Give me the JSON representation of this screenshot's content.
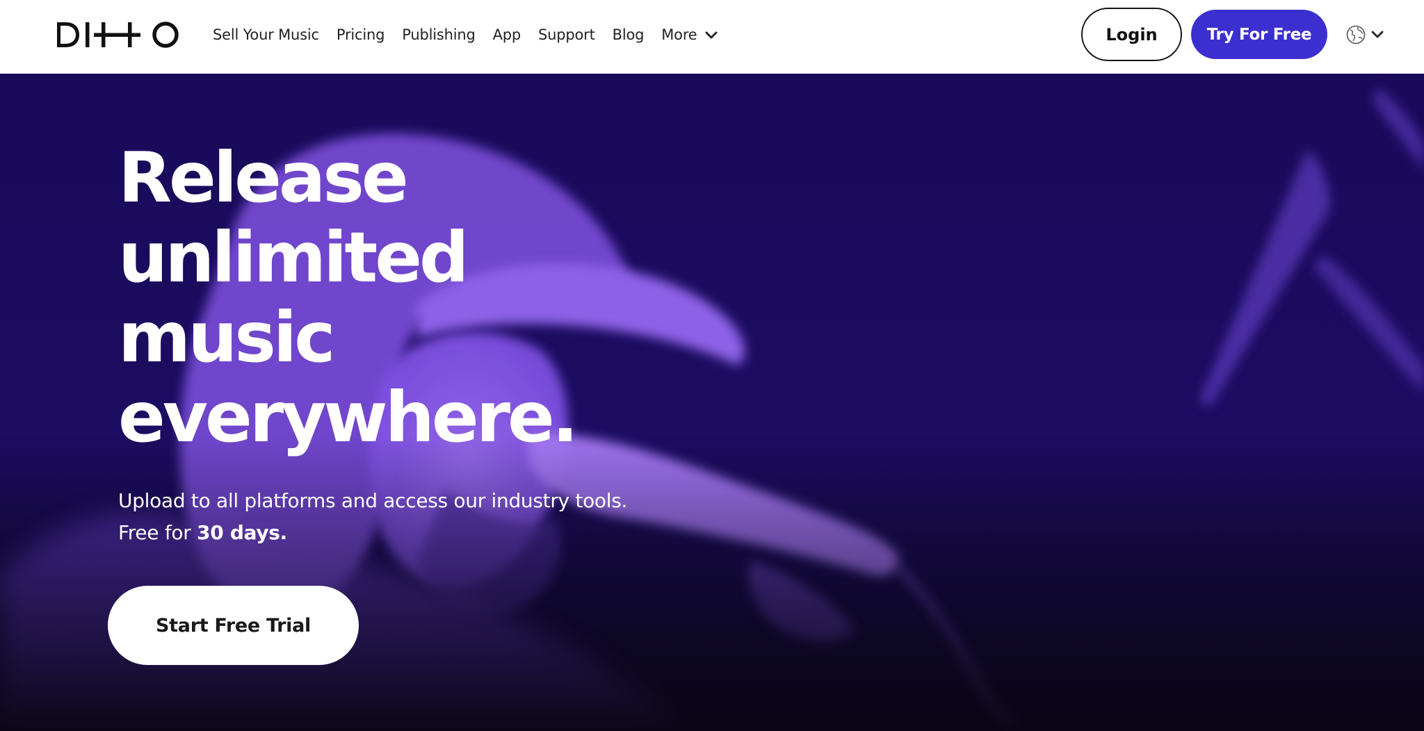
{
  "brand": {
    "logo_text": "DITTO",
    "accent_color": "#3c2fcf"
  },
  "nav": {
    "links": [
      {
        "label": "Sell Your Music"
      },
      {
        "label": "Pricing"
      },
      {
        "label": "Publishing"
      },
      {
        "label": "App"
      },
      {
        "label": "Support"
      },
      {
        "label": "Blog"
      }
    ],
    "more_label": "More",
    "login_label": "Login",
    "try_label": "Try For Free",
    "language_icon": "globe-icon"
  },
  "hero": {
    "headline_lines": [
      "Release",
      "unlimited",
      "music",
      "everywhere."
    ],
    "subtext_main": "Upload to all platforms and access our industry tools. Free for ",
    "subtext_bold": "30 days.",
    "cta_label": "Start Free Trial",
    "background_image": "singer-with-microphone-purple-tint"
  }
}
